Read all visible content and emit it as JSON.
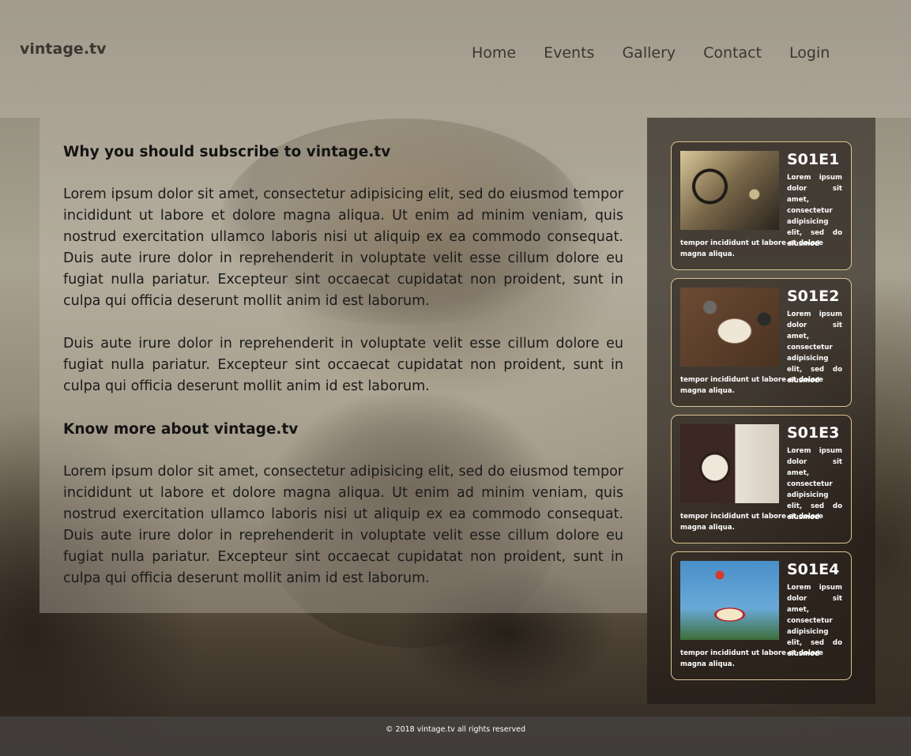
{
  "header": {
    "brand": "vintage.tv",
    "nav": [
      "Home",
      "Events",
      "Gallery",
      "Contact",
      "Login"
    ]
  },
  "article": {
    "heading1": "Why you should subscribe to vintage.tv",
    "para1": "Lorem ipsum dolor sit amet, consectetur adipisicing elit, sed do eiusmod tempor incididunt ut labore et dolore magna aliqua. Ut enim ad minim veniam, quis nostrud exercitation ullamco laboris nisi ut aliquip ex ea commodo consequat. Duis aute irure dolor in reprehenderit in voluptate velit esse cillum dolore eu fugiat nulla pariatur. Excepteur sint occaecat cupidatat non proident, sunt in culpa qui officia deserunt mollit anim id est laborum.",
    "para2": "Duis aute irure dolor in reprehenderit in voluptate velit esse cillum dolore eu fugiat nulla pariatur. Excepteur sint occaecat cupidatat non proident, sunt in culpa qui officia deserunt mollit anim id est laborum.",
    "heading2": "Know more about vintage.tv",
    "para3": "Lorem ipsum dolor sit amet, consectetur adipisicing elit, sed do eiusmod tempor incididunt ut labore et dolore magna aliqua. Ut enim ad minim veniam, quis nostrud exercitation ullamco laboris nisi ut aliquip ex ea commodo consequat. Duis aute irure dolor in reprehenderit in voluptate velit esse cillum dolore eu fugiat nulla pariatur. Excepteur sint occaecat cupidatat non proident, sunt in culpa qui officia deserunt mollit anim id est laborum."
  },
  "episodes": [
    {
      "code": "S01E1",
      "thumb": "vintage-car-dashboard-image",
      "desc_side": "Lorem ipsum dolor sit amet, consectetur adipisicing elit, sed do eiusmod",
      "desc_bottom": "tempor incididunt ut labore et dolore magna aliqua."
    },
    {
      "code": "S01E2",
      "thumb": "notebook-camera-desk-image",
      "desc_side": "Lorem ipsum dolor sit amet, consectetur adipisicing elit, sed do eiusmod",
      "desc_bottom": "tempor incididunt ut labore et dolore magna aliqua."
    },
    {
      "code": "S01E3",
      "thumb": "vintage-alarm-clock-image",
      "desc_side": "Lorem ipsum dolor sit amet, consectetur adipisicing elit, sed do eiusmod",
      "desc_bottom": "tempor incididunt ut labore et dolore magna aliqua."
    },
    {
      "code": "S01E4",
      "thumb": "las-vegas-sign-image",
      "desc_side": "Lorem ipsum dolor sit amet, consectetur adipisicing elit, sed do eiusmod",
      "desc_bottom": "tempor incididunt ut labore et dolore magna aliqua."
    }
  ],
  "footer": {
    "text": "© 2018 vintage.tv all rights reserved"
  }
}
